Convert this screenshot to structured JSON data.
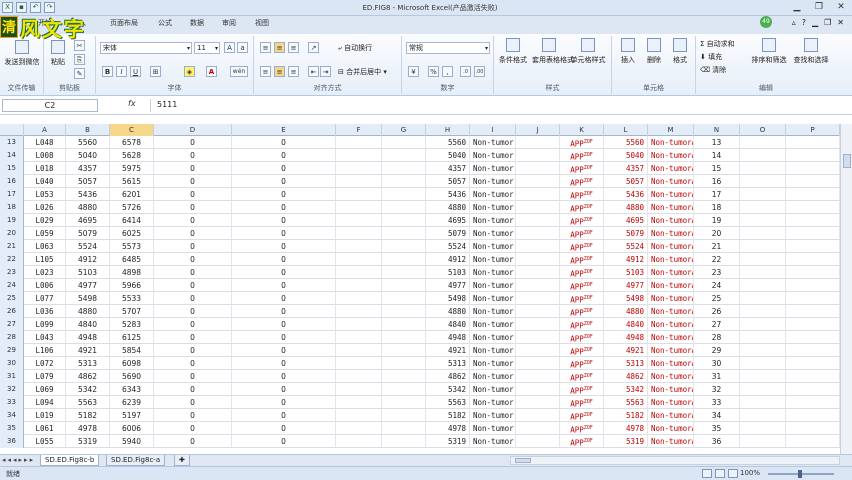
{
  "window": {
    "title": "ED.FIG8 - Microsoft Excel(产品激活失败)",
    "badge": "49"
  },
  "logo": {
    "mark": "清",
    "text": "风文字"
  },
  "tabs": [
    "开始",
    "插入",
    "页面布局",
    "公式",
    "数据",
    "审阅",
    "视图"
  ],
  "ribbon": {
    "groups": [
      "文件传输",
      "剪贴板",
      "字体",
      "对齐方式",
      "数字",
      "样式",
      "单元格",
      "编辑"
    ],
    "send_label": "发送到微信",
    "paste_label": "粘贴",
    "font_name": "宋体",
    "font_size": "11",
    "wrap_label": "自动换行",
    "merge_label": "合并后居中",
    "number_format": "常规",
    "percent": "%",
    "comma": ",",
    "cond_format": "条件格式",
    "table_format": "套用表格格式",
    "cell_style": "单元格样式",
    "insert": "插入",
    "delete": "删除",
    "format": "格式",
    "autosum": "自动求和",
    "fill": "填充",
    "clear": "清除",
    "sort_filter": "排序和筛选",
    "find_select": "查找和选择",
    "bold": "B",
    "italic": "I",
    "underline": "U",
    "font_color_glyph": "A",
    "wen": "wén"
  },
  "formula_bar": {
    "name_box": "C2",
    "fx": "fx",
    "value": "5111"
  },
  "columns": [
    "A",
    "B",
    "C",
    "D",
    "E",
    "F",
    "G",
    "H",
    "I",
    "J",
    "K",
    "L",
    "M",
    "N",
    "O",
    "P"
  ],
  "selected_column": "C",
  "rows": [
    {
      "n": "13",
      "a": "L048",
      "b": "5560",
      "c": "6578",
      "d": "0",
      "e": "0",
      "h": "5560",
      "i": "Non-tumor",
      "k": "APP",
      "l": "5560",
      "m": "Non-tumorA"
    },
    {
      "n": "14",
      "a": "L008",
      "b": "5040",
      "c": "5628",
      "d": "0",
      "e": "0",
      "h": "5040",
      "i": "Non-tumor",
      "k": "APP",
      "l": "5040",
      "m": "Non-tumorA"
    },
    {
      "n": "15",
      "a": "L018",
      "b": "4357",
      "c": "5975",
      "d": "0",
      "e": "0",
      "h": "4357",
      "i": "Non-tumor",
      "k": "APP",
      "l": "4357",
      "m": "Non-tumorA"
    },
    {
      "n": "16",
      "a": "L040",
      "b": "5057",
      "c": "5615",
      "d": "0",
      "e": "0",
      "h": "5057",
      "i": "Non-tumor",
      "k": "APP",
      "l": "5057",
      "m": "Non-tumorA"
    },
    {
      "n": "17",
      "a": "L053",
      "b": "5436",
      "c": "6201",
      "d": "0",
      "e": "0",
      "h": "5436",
      "i": "Non-tumor",
      "k": "APP",
      "l": "5436",
      "m": "Non-tumorA"
    },
    {
      "n": "18",
      "a": "L026",
      "b": "4880",
      "c": "5726",
      "d": "0",
      "e": "0",
      "h": "4880",
      "i": "Non-tumor",
      "k": "APP",
      "l": "4880",
      "m": "Non-tumorA"
    },
    {
      "n": "19",
      "a": "L029",
      "b": "4695",
      "c": "6414",
      "d": "0",
      "e": "0",
      "h": "4695",
      "i": "Non-tumor",
      "k": "APP",
      "l": "4695",
      "m": "Non-tumorA"
    },
    {
      "n": "20",
      "a": "L059",
      "b": "5079",
      "c": "6025",
      "d": "0",
      "e": "0",
      "h": "5079",
      "i": "Non-tumor",
      "k": "APP",
      "l": "5079",
      "m": "Non-tumorA"
    },
    {
      "n": "21",
      "a": "L063",
      "b": "5524",
      "c": "5573",
      "d": "0",
      "e": "0",
      "h": "5524",
      "i": "Non-tumor",
      "k": "APP",
      "l": "5524",
      "m": "Non-tumorA"
    },
    {
      "n": "22",
      "a": "L105",
      "b": "4912",
      "c": "6485",
      "d": "0",
      "e": "0",
      "h": "4912",
      "i": "Non-tumor",
      "k": "APP",
      "l": "4912",
      "m": "Non-tumorA"
    },
    {
      "n": "23",
      "a": "L023",
      "b": "5103",
      "c": "4898",
      "d": "0",
      "e": "0",
      "h": "5103",
      "i": "Non-tumor",
      "k": "APP",
      "l": "5103",
      "m": "Non-tumorA"
    },
    {
      "n": "24",
      "a": "L006",
      "b": "4977",
      "c": "5966",
      "d": "0",
      "e": "0",
      "h": "4977",
      "i": "Non-tumor",
      "k": "APP",
      "l": "4977",
      "m": "Non-tumorA"
    },
    {
      "n": "25",
      "a": "L077",
      "b": "5498",
      "c": "5533",
      "d": "0",
      "e": "0",
      "h": "5498",
      "i": "Non-tumor",
      "k": "APP",
      "l": "5498",
      "m": "Non-tumorA"
    },
    {
      "n": "26",
      "a": "L036",
      "b": "4880",
      "c": "5707",
      "d": "0",
      "e": "0",
      "h": "4880",
      "i": "Non-tumor",
      "k": "APP",
      "l": "4880",
      "m": "Non-tumorA"
    },
    {
      "n": "27",
      "a": "L099",
      "b": "4840",
      "c": "5283",
      "d": "0",
      "e": "0",
      "h": "4840",
      "i": "Non-tumor",
      "k": "APP",
      "l": "4840",
      "m": "Non-tumorA"
    },
    {
      "n": "28",
      "a": "L043",
      "b": "4948",
      "c": "6125",
      "d": "0",
      "e": "0",
      "h": "4948",
      "i": "Non-tumor",
      "k": "APP",
      "l": "4948",
      "m": "Non-tumorA"
    },
    {
      "n": "29",
      "a": "L106",
      "b": "4921",
      "c": "5854",
      "d": "0",
      "e": "0",
      "h": "4921",
      "i": "Non-tumor",
      "k": "APP",
      "l": "4921",
      "m": "Non-tumorA"
    },
    {
      "n": "30",
      "a": "L072",
      "b": "5313",
      "c": "6098",
      "d": "0",
      "e": "0",
      "h": "5313",
      "i": "Non-tumor",
      "k": "APP",
      "l": "5313",
      "m": "Non-tumorA"
    },
    {
      "n": "31",
      "a": "L079",
      "b": "4862",
      "c": "5690",
      "d": "0",
      "e": "0",
      "h": "4862",
      "i": "Non-tumor",
      "k": "APP",
      "l": "4862",
      "m": "Non-tumorA"
    },
    {
      "n": "32",
      "a": "L069",
      "b": "5342",
      "c": "6343",
      "d": "0",
      "e": "0",
      "h": "5342",
      "i": "Non-tumor",
      "k": "APP",
      "l": "5342",
      "m": "Non-tumorA"
    },
    {
      "n": "33",
      "a": "L094",
      "b": "5563",
      "c": "6239",
      "d": "0",
      "e": "0",
      "h": "5563",
      "i": "Non-tumor",
      "k": "APP",
      "l": "5563",
      "m": "Non-tumorA"
    },
    {
      "n": "34",
      "a": "L019",
      "b": "5182",
      "c": "5197",
      "d": "0",
      "e": "0",
      "h": "5182",
      "i": "Non-tumor",
      "k": "APP",
      "l": "5182",
      "m": "Non-tumorA"
    },
    {
      "n": "35",
      "a": "L061",
      "b": "4978",
      "c": "6006",
      "d": "0",
      "e": "0",
      "h": "4978",
      "i": "Non-tumor",
      "k": "APP",
      "l": "4978",
      "m": "Non-tumorA"
    },
    {
      "n": "36",
      "a": "L055",
      "b": "5319",
      "c": "5940",
      "d": "0",
      "e": "0",
      "h": "5319",
      "i": "Non-tumor",
      "k": "APP",
      "l": "5319",
      "m": "Non-tumorA"
    }
  ],
  "app_superscript": "ZOF",
  "sheets": [
    "SD.ED.Fig8c-b",
    "SD.ED.Fig8c-a"
  ],
  "status": {
    "text": "就绪",
    "zoom": "100%"
  },
  "colors": {
    "accent": "#c00000",
    "header_bg": "#e4ecf7",
    "selected_header": "#f6d78a"
  }
}
